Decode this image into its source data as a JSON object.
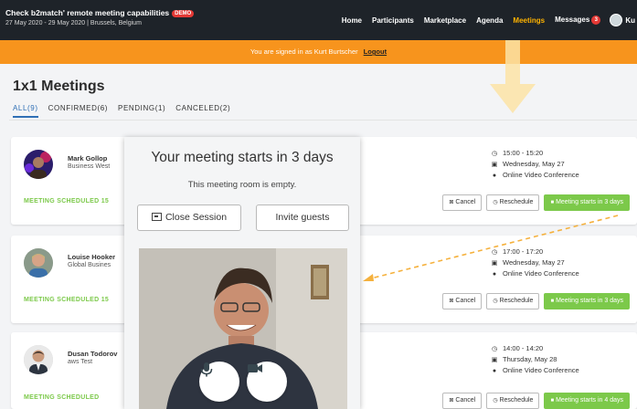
{
  "app": {
    "title": "Check b2match' remote meeting capabilities",
    "demo_badge": "DEMO",
    "subtitle": "27 May 2020 - 29 May 2020 | Brussels, Belgium"
  },
  "nav": {
    "items": [
      "Home",
      "Participants",
      "Marketplace",
      "Agenda",
      "Meetings",
      "Messages"
    ],
    "active": "Meetings",
    "messages_badge": "3",
    "user_label": "Ku"
  },
  "banner": {
    "text": "You are signed in as Kurt Burtscher",
    "logout": "Logout"
  },
  "page": {
    "title": "1x1 Meetings",
    "tabs": [
      "ALL(9)",
      "CONFIRMED(6)",
      "PENDING(1)",
      "CANCELED(2)"
    ]
  },
  "meetings": [
    {
      "name": "Mark Gollop",
      "org": "Business West",
      "status": "MEETING SCHEDULED 15",
      "time": "15:00 - 15:20",
      "date": "Wednesday, May 27",
      "location": "Online Video Conference",
      "actions": [
        "Cancel",
        "Reschedule"
      ],
      "cta": "Meeting starts in 3 days"
    },
    {
      "name": "Louise Hooker",
      "org": "Global Busines",
      "status": "MEETING SCHEDULED 15",
      "time": "17:00 - 17:20",
      "date": "Wednesday, May 27",
      "location": "Online Video Conference",
      "actions": [
        "Cancel",
        "Reschedule"
      ],
      "cta": "Meeting starts in 3 days"
    },
    {
      "name": "Dusan Todorov",
      "org": "aws Test",
      "status": "MEETING SCHEDULED",
      "time": "14:00 - 14:20",
      "date": "Thursday, May 28",
      "location": "Online Video Conference",
      "actions": [
        "Cancel",
        "Reschedule"
      ],
      "cta": "Meeting starts in 4 days"
    }
  ],
  "overlay": {
    "title": "Your meeting starts in 3 days",
    "subtitle": "This meeting room is empty.",
    "close_label": "Close Session",
    "invite_label": "Invite guests"
  },
  "icons": {
    "time": "clock-icon",
    "date": "calendar-icon",
    "location": "map-pin-icon",
    "cancel": "cancel-icon",
    "reschedule": "reschedule-icon",
    "cta": "video-camera-icon",
    "mic": "microphone-icon",
    "camera": "camera-icon"
  },
  "colors": {
    "nav_bg": "#1e2329",
    "nav_active": "#ffb300",
    "banner": "#f7941d",
    "accent_blue": "#2f6fb5",
    "status_green": "#7cc94a",
    "badge_red": "#e53935"
  }
}
